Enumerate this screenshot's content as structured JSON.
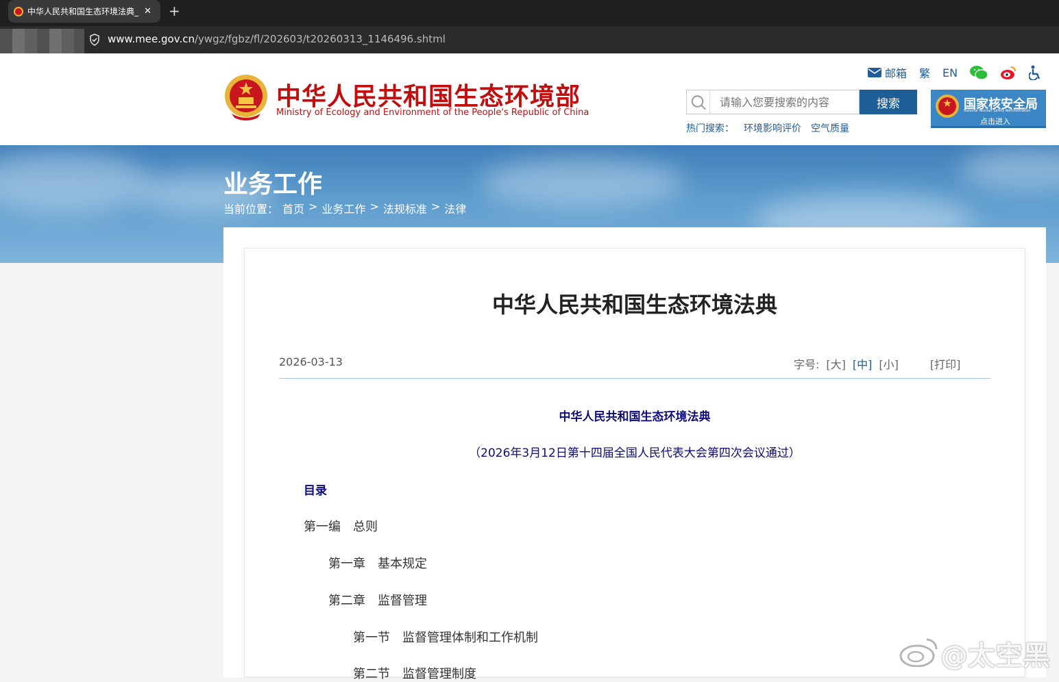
{
  "browser": {
    "tab_title": "中华人民共和国生态环境法典_",
    "url_domain": "www.mee.gov.cn",
    "url_path": "/ywgz/fgbz/fl/202603/t20260313_1146496.shtml"
  },
  "header": {
    "site_name_zh": "中华人民共和国生态环境部",
    "site_name_en": "Ministry of Ecology and Environment of the People's Republic of China",
    "links": {
      "mail": "邮箱",
      "traditional": "繁",
      "english": "EN"
    },
    "search": {
      "placeholder": "请输入您要搜索的内容",
      "button": "搜索"
    },
    "hot_search": {
      "label": "热门搜索：",
      "items": [
        "环境影响评价",
        "空气质量"
      ]
    },
    "nnsa": {
      "name": "国家核安全局",
      "name_en": "National Nuclear Safety Administration",
      "enter": "点击进入"
    }
  },
  "banner": {
    "section_title": "业务工作",
    "breadcrumb": {
      "label": "当前位置：",
      "items": [
        "首页",
        "业务工作",
        "法规标准",
        "法律"
      ],
      "sep": ">"
    }
  },
  "article": {
    "title": "中华人民共和国生态环境法典",
    "date": "2026-03-13",
    "font_size": {
      "label": "字号:",
      "large": "[大]",
      "medium": "[中]",
      "small": "[小]",
      "print": "[打印]"
    },
    "law_title": "中华人民共和国生态环境法典",
    "law_subtitle": "（2026年3月12日第十四届全国人民代表大会第四次会议通过）",
    "toc_heading": "目录",
    "toc": [
      "第一编　总则",
      "第一章　基本规定",
      "第二章　监督管理",
      "第一节　监督管理体制和工作机制",
      "第二节　监督管理制度"
    ]
  },
  "watermark": "@太空黑",
  "colors": {
    "brand_red": "#c00e0e",
    "link_blue": "#1f5c9a",
    "law_navy": "#0c0c7a",
    "search_btn": "#1e5e96"
  }
}
